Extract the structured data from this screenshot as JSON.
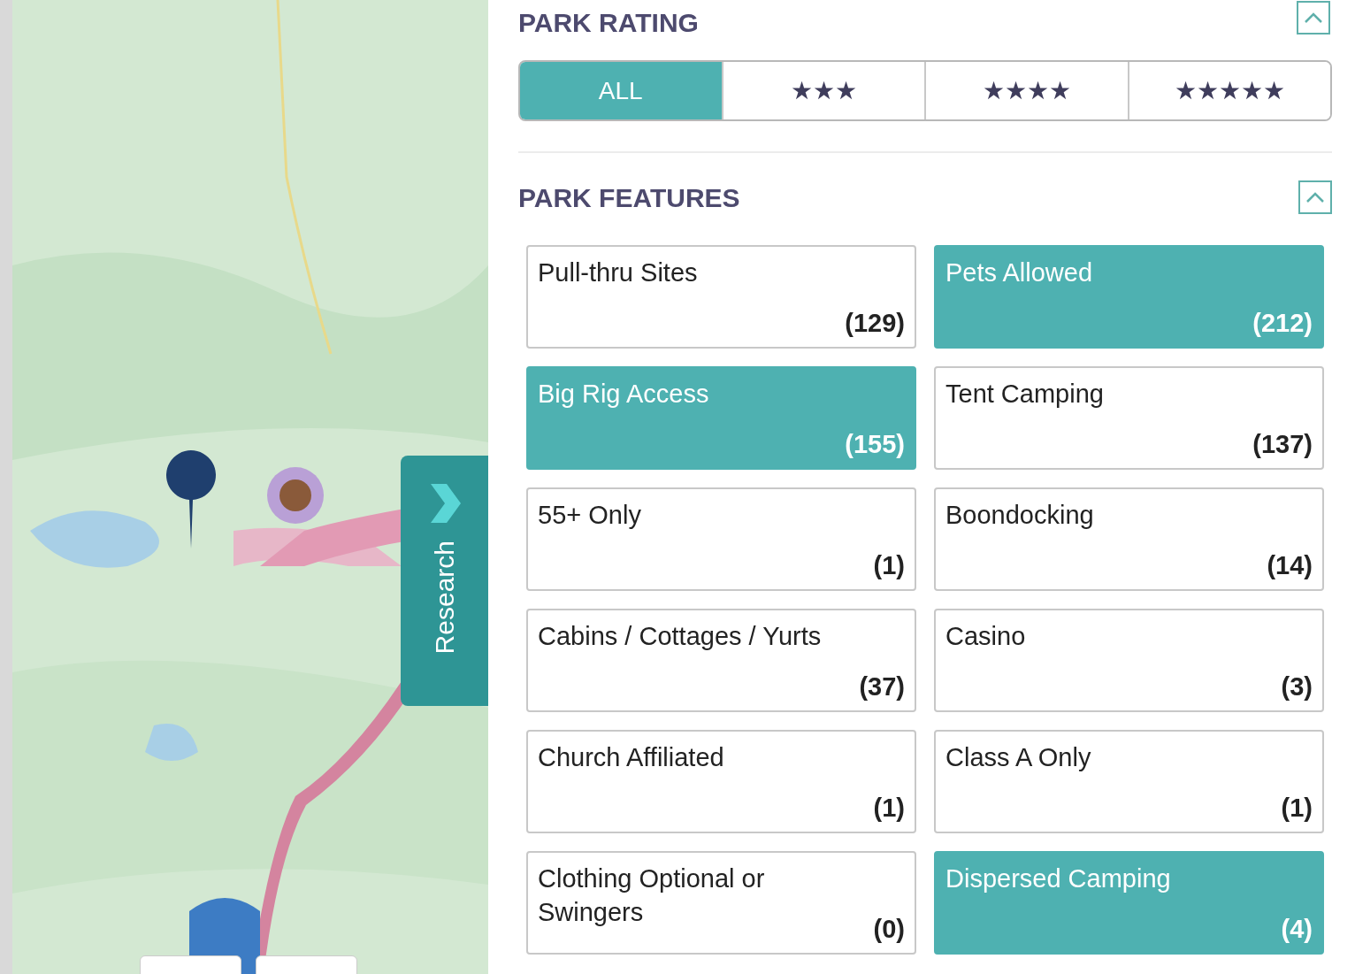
{
  "research_tab": {
    "label": "Research"
  },
  "park_rating": {
    "title": "PARK RATING",
    "expanded": true,
    "options": [
      {
        "label": "ALL",
        "selected": true
      },
      {
        "label": "★★★",
        "selected": false
      },
      {
        "label": "★★★★",
        "selected": false
      },
      {
        "label": "★★★★★",
        "selected": false
      }
    ]
  },
  "park_features": {
    "title": "PARK FEATURES",
    "expanded": true,
    "items": [
      {
        "label": "Pull-thru Sites",
        "count": "(129)",
        "selected": false
      },
      {
        "label": "Pets Allowed",
        "count": "(212)",
        "selected": true
      },
      {
        "label": "Big Rig Access",
        "count": "(155)",
        "selected": true
      },
      {
        "label": "Tent Camping",
        "count": "(137)",
        "selected": false
      },
      {
        "label": "55+ Only",
        "count": "(1)",
        "selected": false
      },
      {
        "label": "Boondocking",
        "count": "(14)",
        "selected": false
      },
      {
        "label": "Cabins / Cottages / Yurts",
        "count": "(37)",
        "selected": false
      },
      {
        "label": "Casino",
        "count": "(3)",
        "selected": false
      },
      {
        "label": "Church Affiliated",
        "count": "(1)",
        "selected": false
      },
      {
        "label": "Class A Only",
        "count": "(1)",
        "selected": false
      },
      {
        "label": "Clothing Optional or Swingers",
        "count": "(0)",
        "selected": false
      },
      {
        "label": "Dispersed Camping",
        "count": "(4)",
        "selected": true
      }
    ]
  }
}
